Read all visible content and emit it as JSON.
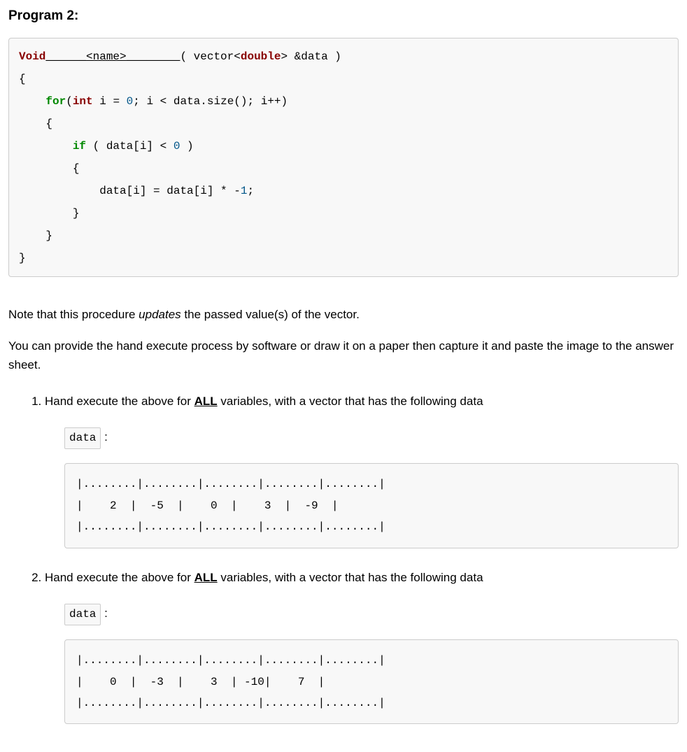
{
  "heading": "Program 2:",
  "code": {
    "void": "Void",
    "name_blank_prefix": "______",
    "name_placeholder": "<name>",
    "name_blank_suffix": "________",
    "signature_rest_prefix": "( vector<",
    "double": "double",
    "signature_rest_suffix": "> &data )",
    "open_brace": "{",
    "for_kw": "for",
    "int_kw": "int",
    "for_line_prefix": "(",
    "for_line_mid": " i = ",
    "zero": "0",
    "for_line_rest": "; i < data.size(); i++)",
    "open_brace2": "    {",
    "if_kw": "if",
    "if_cond_prefix": " ( data[i] < ",
    "if_cond_suffix": " )",
    "open_brace3": "        {",
    "body_line_prefix": "            data[i] = data[i] * -",
    "one": "1",
    "body_line_suffix": ";",
    "close_brace3": "        }",
    "close_brace2": "    }",
    "close_brace": "}"
  },
  "note_prefix": "Note that this procedure ",
  "note_italic": "updates",
  "note_suffix": " the passed value(s) of the vector.",
  "instructions": "You can provide the hand execute process by software or draw it on a paper then capture it and paste the image to the answer sheet.",
  "questions": {
    "q1_prefix": "Hand execute the above for ",
    "all_label": "ALL",
    "q1_suffix": " variables, with a vector that has the following data",
    "data_label": "data",
    "q2_prefix": "Hand execute the above for ",
    "q2_suffix": " variables, with a vector that has the following data",
    "table1": {
      "border": "|........|........|........|........|........|",
      "row": "|    2  |  -5  |    0  |    3  |  -9  |"
    },
    "table2": {
      "border": "|........|........|........|........|........|",
      "row": "|    0  |  -3  |    3  | -10|    7  |"
    }
  }
}
